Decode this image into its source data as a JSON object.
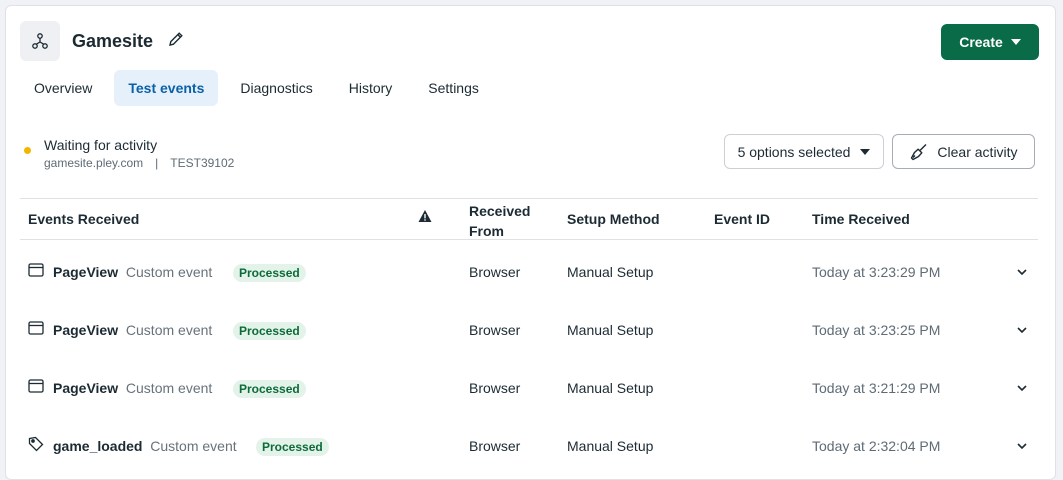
{
  "header": {
    "title": "Gamesite",
    "create_label": "Create"
  },
  "tabs": [
    {
      "label": "Overview"
    },
    {
      "label": "Test events"
    },
    {
      "label": "Diagnostics"
    },
    {
      "label": "History"
    },
    {
      "label": "Settings"
    }
  ],
  "active_tab": "Test events",
  "status": {
    "title": "Waiting for activity",
    "domain": "gamesite.pley.com",
    "separator": "|",
    "code": "TEST39102",
    "dot_color": "#f2b600"
  },
  "toolbar": {
    "options_label": "5 options selected",
    "clear_label": "Clear activity"
  },
  "table": {
    "headers": {
      "events": "Events Received",
      "received_from": "Received From",
      "setup_method": "Setup Method",
      "event_id": "Event ID",
      "time_received": "Time Received"
    },
    "rows": [
      {
        "icon": "browser-window-icon",
        "name": "PageView",
        "type": "Custom event",
        "status": "Processed",
        "received_from": "Browser",
        "setup_method": "Manual Setup",
        "event_id": "",
        "time": "Today at 3:23:29 PM"
      },
      {
        "icon": "browser-window-icon",
        "name": "PageView",
        "type": "Custom event",
        "status": "Processed",
        "received_from": "Browser",
        "setup_method": "Manual Setup",
        "event_id": "",
        "time": "Today at 3:23:25 PM"
      },
      {
        "icon": "browser-window-icon",
        "name": "PageView",
        "type": "Custom event",
        "status": "Processed",
        "received_from": "Browser",
        "setup_method": "Manual Setup",
        "event_id": "",
        "time": "Today at 3:21:29 PM"
      },
      {
        "icon": "tag-icon",
        "name": "game_loaded",
        "type": "Custom event",
        "status": "Processed",
        "received_from": "Browser",
        "setup_method": "Manual Setup",
        "event_id": "",
        "time": "Today at 2:32:04 PM"
      }
    ]
  },
  "colors": {
    "primary": "#0a6b48",
    "active_tab_bg": "#e6f0fa",
    "active_tab_text": "#0b61a8",
    "badge_bg": "#e3f3e9",
    "badge_text": "#0d6b3a"
  }
}
